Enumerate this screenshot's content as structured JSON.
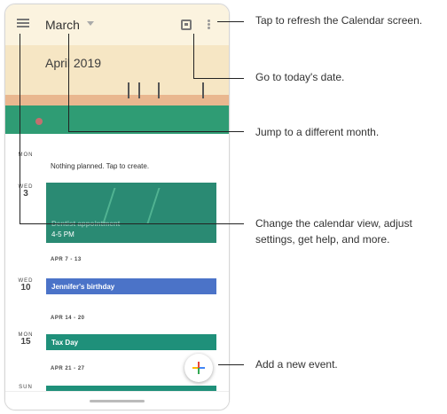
{
  "app": {
    "month_button": "March",
    "banner_title": "April 2019",
    "empty_day_note": "Nothing planned. Tap to create.",
    "days": [
      {
        "dow": "MON",
        "num": ""
      },
      {
        "dow": "WED",
        "num": "3"
      },
      {
        "dow": "WED",
        "num": "10"
      },
      {
        "dow": "MON",
        "num": "15"
      },
      {
        "dow": "SUN",
        "num": ""
      }
    ],
    "ranges": [
      "APR 7 - 13",
      "APR 14 - 20",
      "APR 21 - 27"
    ],
    "events": [
      {
        "title": "Dentist appointment",
        "time": "4-5 PM"
      },
      {
        "title": "Jennifer's birthday"
      },
      {
        "title": "Tax Day"
      }
    ]
  },
  "callouts": {
    "refresh": "Tap to refresh the Calendar screen.",
    "today": "Go to today's date.",
    "month": "Jump to a different month.",
    "menu": "Change the calendar view, adjust settings, get help, and more.",
    "add": "Add a new event."
  }
}
